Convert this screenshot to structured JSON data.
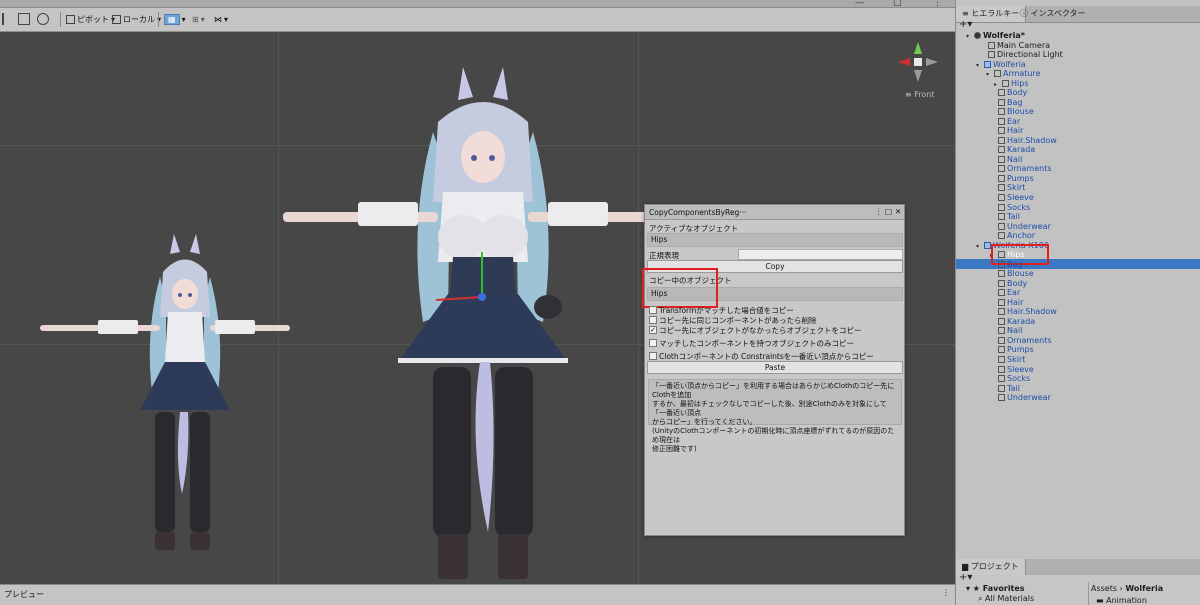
{
  "toolbar": {
    "pivot_label": "ピボット",
    "local_label": "ローカル"
  },
  "scene": {
    "view_label": "Front"
  },
  "bottom": {
    "preview_label": "プレビュー"
  },
  "right_tabs": {
    "hierarchy": "ヒエラルキー",
    "inspector": "インスペクター"
  },
  "hierarchy": {
    "plus": "+▾",
    "scene_name": "Wolferia*",
    "main_camera": "Main Camera",
    "directional_light": "Directional Light",
    "wolferia": "Wolferia",
    "armature": "Armature",
    "hips": "Hips",
    "wolferia_children": [
      "Body",
      "Bag",
      "Blouse",
      "Ear",
      "Hair",
      "Hair.Shadow",
      "Karada",
      "Nail",
      "Ornaments",
      "Pumps",
      "Skirt",
      "Sleeve",
      "Socks",
      "Tail",
      "Underwear",
      "Anchor"
    ],
    "wolferia_x100": "Wolferia-X100",
    "x100_hips": "Hips",
    "x100_children": [
      "Bag",
      "Blouse",
      "Body",
      "Ear",
      "Hair",
      "Hair.Shadow",
      "Karada",
      "Nail",
      "Ornaments",
      "Pumps",
      "Skirt",
      "Sleeve",
      "Socks",
      "Tail",
      "Underwear"
    ]
  },
  "project": {
    "tab": "プロジェクト",
    "plus": "+▾",
    "favorites": "Favorites",
    "all_materials": "All Materials",
    "breadcrumb_root": "Assets",
    "breadcrumb_sep": "›",
    "breadcrumb_folder": "Wolferia",
    "folder": "Animation"
  },
  "copy_window": {
    "title": "CopyComponentsByReg···",
    "active_object_label": "アクティブなオブジェクト",
    "active_object_value": "Hips",
    "regex_label": "正規表現",
    "regex_value": "",
    "copy_button": "Copy",
    "copying_label": "コピー中のオブジェクト",
    "copying_value": "Hips",
    "options": [
      {
        "label": "Transformがマッチした場合値をコピー",
        "checked": false
      },
      {
        "label": "コピー先に同じコンポーネントがあったら削除",
        "checked": false
      },
      {
        "label": "コピー先にオブジェクトがなかったらオブジェクトをコピー",
        "checked": true
      },
      {
        "label": "マッチしたコンポーネントを持つオブジェクトのみコピー",
        "checked": false
      },
      {
        "label": "Clothコンポーネントの Constraintsを一番近い頂点からコピー",
        "checked": false
      }
    ],
    "paste_button": "Paste",
    "note_lines": [
      "「一番近い頂点からコピー」を利用する場合はあらかじめClothのコピー先にClothを追加",
      "するか、最初はチェックなしでコピーした後、別途Clothのみを対象にして「一番近い頂点",
      "からコピー」を行ってください。",
      "(UnityのClothコンポーネントの初期化時に頂点座標がずれてるのが原因のため現在は",
      "修正困難です)"
    ]
  },
  "colors": {
    "scene_bg": "#474747",
    "selection": "#3a78c4",
    "highlight": "#e31e1e",
    "hierarchy_blue": "#1f4ea6"
  }
}
